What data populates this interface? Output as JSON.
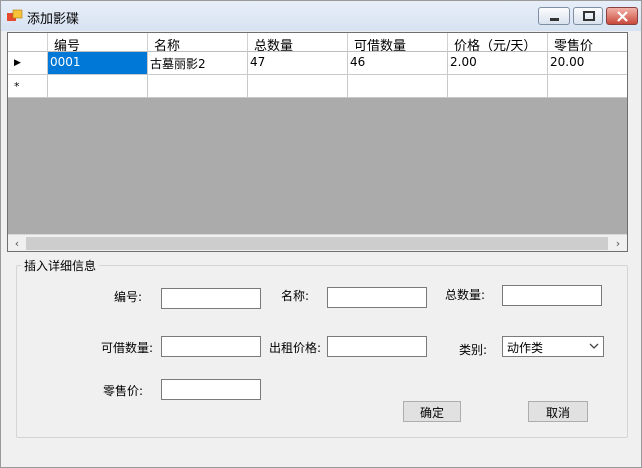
{
  "window": {
    "title": "添加影碟"
  },
  "grid": {
    "columns": [
      "编号",
      "名称",
      "总数量",
      "可借数量",
      "价格（元/天）",
      "零售价"
    ],
    "rows": [
      [
        "0001",
        "古墓丽影2",
        "47",
        "46",
        "2.00",
        "20.00"
      ]
    ],
    "current_row_marker": "▶",
    "new_row_marker": "*"
  },
  "form": {
    "group_title": "插入详细信息",
    "labels": {
      "id": "编号:",
      "name": "名称:",
      "total": "总数量:",
      "available": "可借数量:",
      "rent_price": "出租价格:",
      "category": "类别:",
      "retail": "零售价:"
    },
    "values": {
      "id": "",
      "name": "",
      "total": "",
      "available": "",
      "rent_price": "",
      "retail": ""
    },
    "category_selected": "动作类",
    "ok_label": "确定",
    "cancel_label": "取消"
  }
}
